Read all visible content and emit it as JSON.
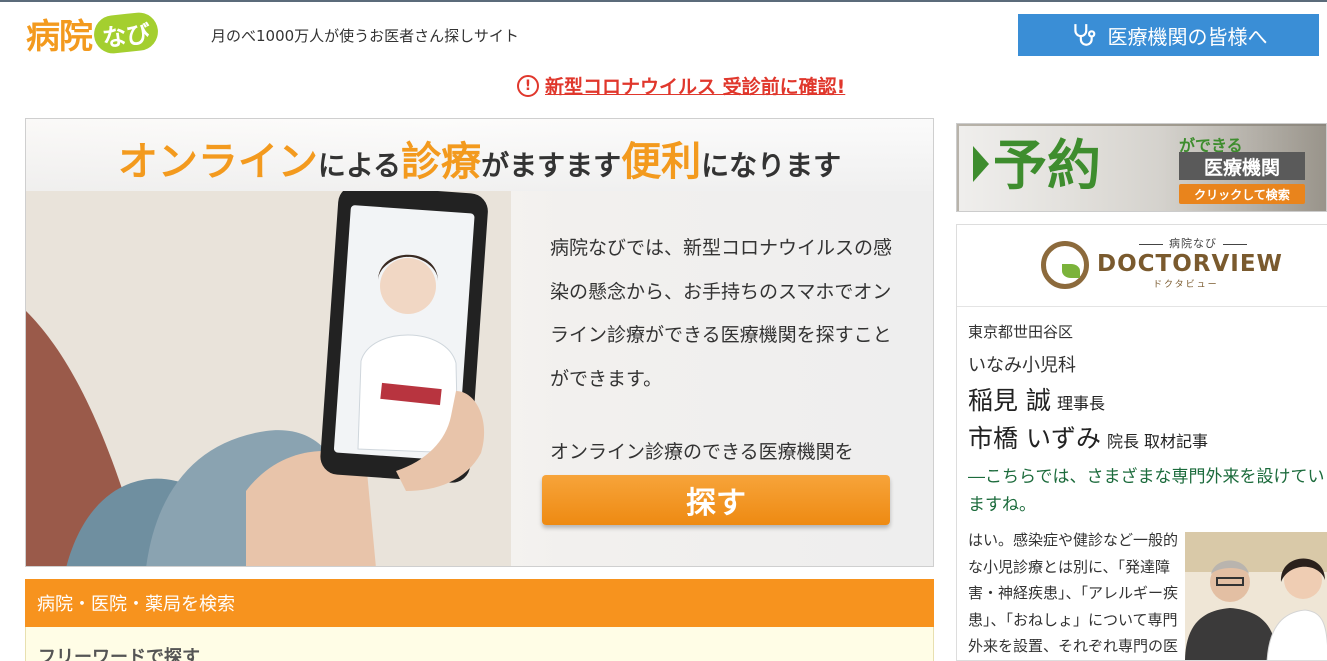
{
  "header": {
    "logo_text": "病院",
    "logo_badge": "なび",
    "tagline": "月のべ1000万人が使うお医者さん探しサイト",
    "for_medical_label": "医療機関の皆様へ"
  },
  "notice": {
    "icon": "exclamation-circle-icon",
    "text": "新型コロナウイルス 受診前に確認!"
  },
  "banner": {
    "head_parts": [
      "オンライン",
      "による",
      "診療",
      "がますます",
      "便利",
      "になります"
    ],
    "text": "病院なびでは、新型コロナウイルスの感染の懸念から、お手持ちのスマホでオンライン診療ができる医療機関を探すことができます。",
    "sub": "オンライン診療のできる医療機関を",
    "button_label": "探す"
  },
  "search": {
    "heading": "病院・医院・薬局を検索",
    "freeword_label": "フリーワードで探す"
  },
  "reserve": {
    "big": "予約",
    "can": "ができる",
    "institution": "医療機関",
    "click": "クリックして検索"
  },
  "doctorview": {
    "small": "病院なび",
    "name": "DOCTORVIEW",
    "kana": "ドクタビュー",
    "area": "東京都世田谷区",
    "clinic": "いなみ小児科",
    "doctors": [
      {
        "name": "稲見 誠",
        "role": "理事長"
      },
      {
        "name": "市橋 いずみ",
        "role": "院長 取材記事"
      }
    ],
    "question": "―こちらでは、さまざまな専門外来を設けていますね。",
    "answer": "はい。感染症や健診など一般的な小児診療とは別に、「発達障害・神経疾患」、「アレルギー疾患」、「おねしょ」について専門外来を設置、それぞれ専門の医"
  },
  "colors": {
    "brand_orange": "#f7931e",
    "brand_green": "#a4cf2f",
    "link_blue": "#3a8ed6",
    "alert_red": "#e0372c"
  }
}
